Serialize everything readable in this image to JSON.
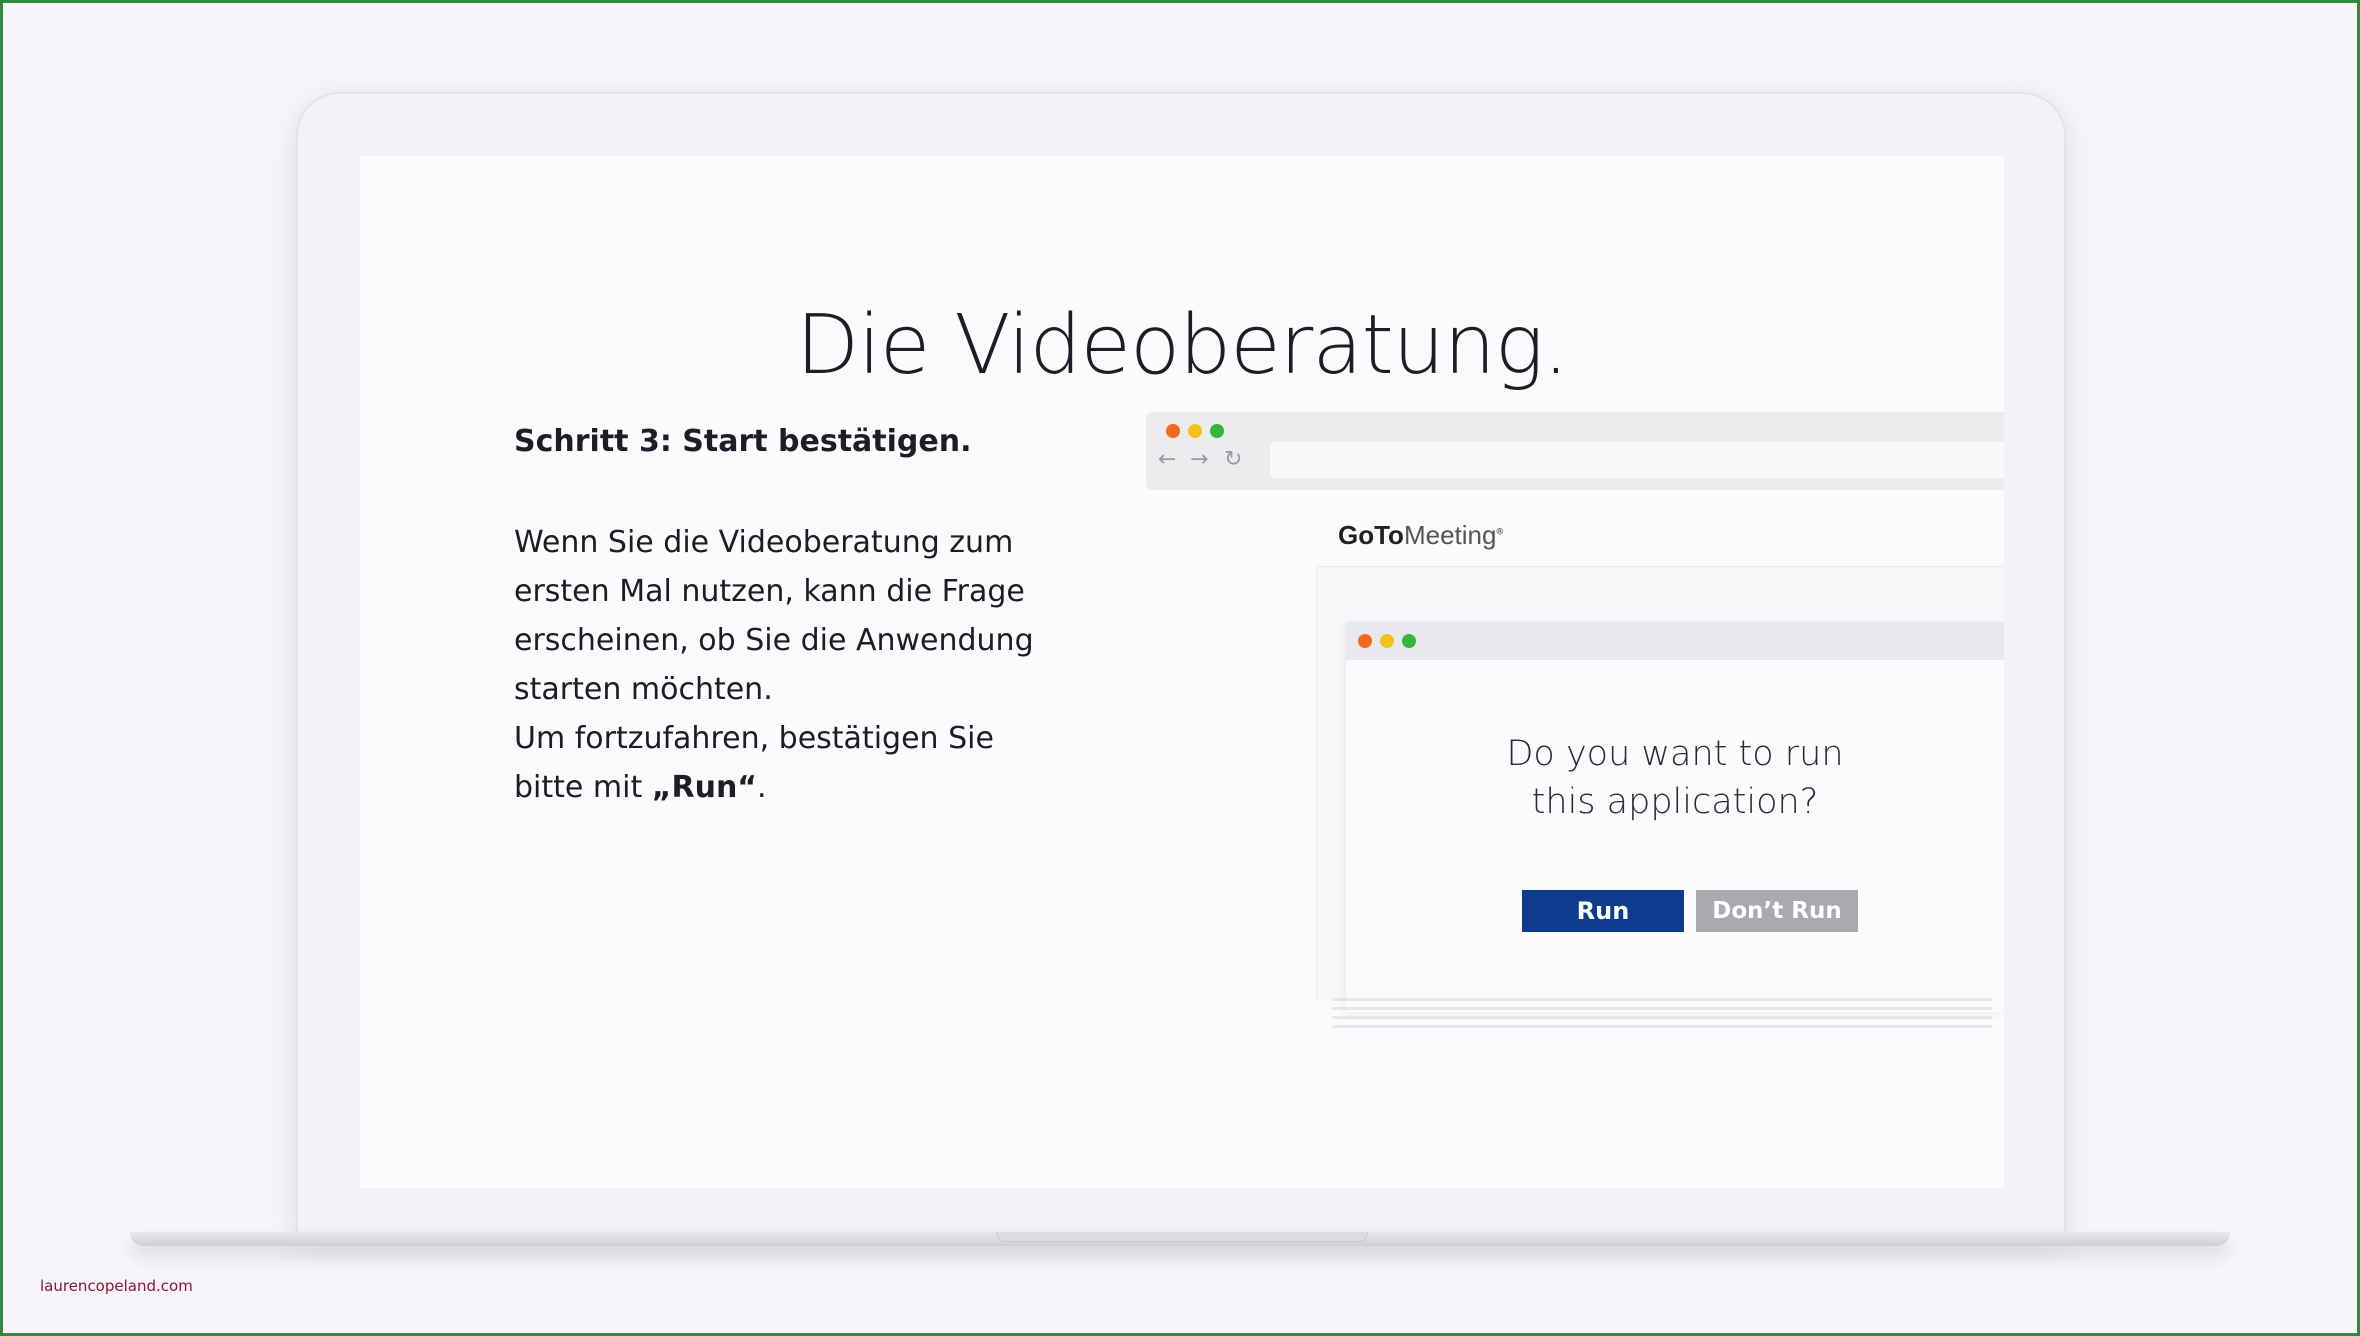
{
  "slide": {
    "title": "Die Videoberatung.",
    "step_heading": "Schritt 3: Start bestätigen.",
    "paragraph_part1": "Wenn Sie die Videoberatung zum ersten Mal nutzen, kann die Frage erscheinen, ob Sie die Anwendung starten möchten.",
    "paragraph_part2_prefix": "Um fortzufahren, bestätigen Sie bitte mit ",
    "paragraph_part2_emphasis": "„Run“",
    "paragraph_part2_suffix": "."
  },
  "browser": {
    "back_icon": "←",
    "forward_icon": "→",
    "reload_icon": "↻",
    "traffic_light_colors": [
      "#ef6a1a",
      "#f2c21b",
      "#36b53a"
    ]
  },
  "gotomeeting": {
    "logo_bold": "GoTo",
    "logo_regular": "Meeting",
    "logo_mark": "®"
  },
  "dialog": {
    "question_line1": "Do you want to run",
    "question_line2": "this application?",
    "run_label": "Run",
    "dont_run_label": "Don’t Run",
    "run_color": "#0d3b8e",
    "dont_run_color": "#a9a9ae"
  },
  "watermark": "laurencopeland.com"
}
